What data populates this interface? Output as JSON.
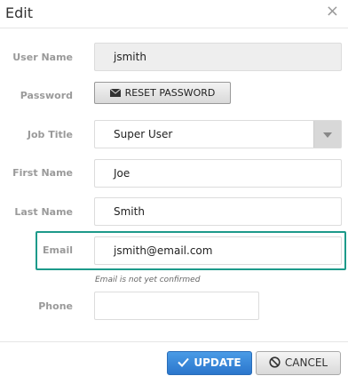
{
  "dialog": {
    "title": "Edit",
    "close_symbol": "×"
  },
  "form": {
    "username": {
      "label": "User Name",
      "value": "jsmith"
    },
    "password": {
      "label": "Password",
      "reset_label": "RESET PASSWORD",
      "icon": "envelope-icon"
    },
    "job_title": {
      "label": "Job Title",
      "value": "Super User"
    },
    "first_name": {
      "label": "First Name",
      "value": "Joe"
    },
    "last_name": {
      "label": "Last Name",
      "value": "Smith"
    },
    "email": {
      "label": "Email",
      "value": "jsmith@email.com",
      "hint": "Email is not yet confirmed",
      "highlight_color": "#1d9a8a"
    },
    "phone": {
      "label": "Phone",
      "value": ""
    }
  },
  "footer": {
    "update_label": "UPDATE",
    "cancel_label": "CANCEL"
  },
  "colors": {
    "primary": "#2b76cc",
    "label": "#9a9a9a"
  }
}
